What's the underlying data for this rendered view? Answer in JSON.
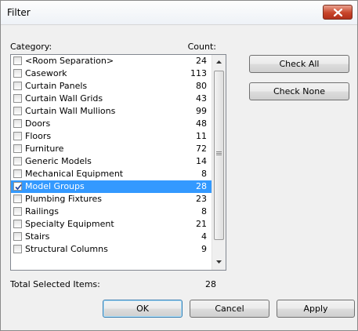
{
  "window": {
    "title": "Filter",
    "close_icon": "close-icon"
  },
  "labels": {
    "category": "Category:",
    "count": "Count:",
    "total_selected": "Total Selected Items:",
    "total_value": "28"
  },
  "categories": [
    {
      "name": "<Room Separation>",
      "count": "24",
      "checked": false,
      "selected": false
    },
    {
      "name": "Casework",
      "count": "113",
      "checked": false,
      "selected": false
    },
    {
      "name": "Curtain Panels",
      "count": "80",
      "checked": false,
      "selected": false
    },
    {
      "name": "Curtain Wall Grids",
      "count": "43",
      "checked": false,
      "selected": false
    },
    {
      "name": "Curtain Wall Mullions",
      "count": "99",
      "checked": false,
      "selected": false
    },
    {
      "name": "Doors",
      "count": "48",
      "checked": false,
      "selected": false
    },
    {
      "name": "Floors",
      "count": "11",
      "checked": false,
      "selected": false
    },
    {
      "name": "Furniture",
      "count": "72",
      "checked": false,
      "selected": false
    },
    {
      "name": "Generic Models",
      "count": "14",
      "checked": false,
      "selected": false
    },
    {
      "name": "Mechanical Equipment",
      "count": "8",
      "checked": false,
      "selected": false
    },
    {
      "name": "Model Groups",
      "count": "28",
      "checked": true,
      "selected": true
    },
    {
      "name": "Plumbing Fixtures",
      "count": "23",
      "checked": false,
      "selected": false
    },
    {
      "name": "Railings",
      "count": "8",
      "checked": false,
      "selected": false
    },
    {
      "name": "Specialty Equipment",
      "count": "21",
      "checked": false,
      "selected": false
    },
    {
      "name": "Stairs",
      "count": "4",
      "checked": false,
      "selected": false
    },
    {
      "name": "Structural Columns",
      "count": "9",
      "checked": false,
      "selected": false
    }
  ],
  "buttons": {
    "check_all": "Check All",
    "check_none": "Check None",
    "ok": "OK",
    "cancel": "Cancel",
    "apply": "Apply"
  },
  "colors": {
    "selection": "#3399ff",
    "close_button": "#c8452a"
  }
}
